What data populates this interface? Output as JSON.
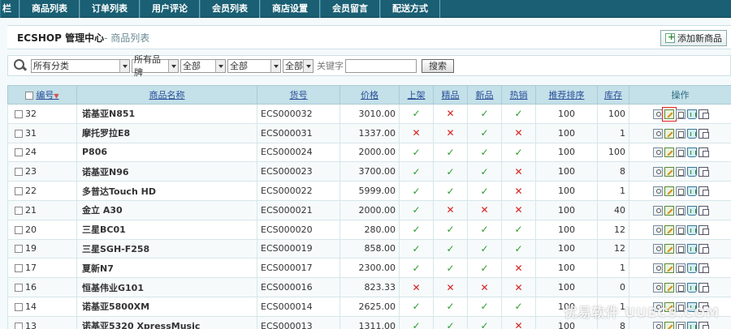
{
  "topnav": {
    "tabs": [
      {
        "label": "栏",
        "width": 24
      },
      {
        "label": "商品列表",
        "width": 74
      },
      {
        "label": "订单列表",
        "width": 74
      },
      {
        "label": "用户评论",
        "width": 74
      },
      {
        "label": "会员列表",
        "width": 74
      },
      {
        "label": "商店设置",
        "width": 74
      },
      {
        "label": "会员留言",
        "width": 74
      },
      {
        "label": "配送方式",
        "width": 74
      }
    ]
  },
  "header": {
    "title": "ECSHOP 管理中心",
    "subtitle": "- 商品列表",
    "add_button": "添加新商品"
  },
  "search": {
    "category": "所有分类",
    "brand": "所有品牌",
    "filter1": "全部",
    "filter2": "全部",
    "filter3": "全部",
    "keyword_label": "关键字",
    "keyword_value": "",
    "button": "搜索"
  },
  "table": {
    "columns": {
      "id": "编号",
      "name": "商品名称",
      "sn": "货号",
      "price": "价格",
      "on_sale": "上架",
      "best": "精品",
      "new": "新品",
      "hot": "热销",
      "sort": "推荐排序",
      "stock": "库存",
      "ops": "操作"
    },
    "rows": [
      {
        "id": "32",
        "name": "诺基亚N851",
        "sn": "ECS000032",
        "price": "3010.00",
        "on_sale": true,
        "best": false,
        "new": true,
        "hot": true,
        "sort": "100",
        "stock": "100"
      },
      {
        "id": "31",
        "name": "摩托罗拉E8",
        "sn": "ECS000031",
        "price": "1337.00",
        "on_sale": false,
        "best": false,
        "new": true,
        "hot": false,
        "sort": "100",
        "stock": "1"
      },
      {
        "id": "24",
        "name": "P806",
        "sn": "ECS000024",
        "price": "2000.00",
        "on_sale": true,
        "best": true,
        "new": true,
        "hot": true,
        "sort": "100",
        "stock": "100"
      },
      {
        "id": "23",
        "name": "诺基亚N96",
        "sn": "ECS000023",
        "price": "3700.00",
        "on_sale": true,
        "best": true,
        "new": true,
        "hot": false,
        "sort": "100",
        "stock": "8"
      },
      {
        "id": "22",
        "name": "多普达Touch HD",
        "sn": "ECS000022",
        "price": "5999.00",
        "on_sale": true,
        "best": true,
        "new": true,
        "hot": false,
        "sort": "100",
        "stock": "1"
      },
      {
        "id": "21",
        "name": "金立 A30",
        "sn": "ECS000021",
        "price": "2000.00",
        "on_sale": true,
        "best": false,
        "new": false,
        "hot": false,
        "sort": "100",
        "stock": "40"
      },
      {
        "id": "20",
        "name": "三星BC01",
        "sn": "ECS000020",
        "price": "280.00",
        "on_sale": true,
        "best": true,
        "new": true,
        "hot": true,
        "sort": "100",
        "stock": "12"
      },
      {
        "id": "19",
        "name": "三星SGH-F258",
        "sn": "ECS000019",
        "price": "858.00",
        "on_sale": true,
        "best": true,
        "new": true,
        "hot": true,
        "sort": "100",
        "stock": "12"
      },
      {
        "id": "17",
        "name": "夏新N7",
        "sn": "ECS000017",
        "price": "2300.00",
        "on_sale": true,
        "best": true,
        "new": true,
        "hot": false,
        "sort": "100",
        "stock": "1"
      },
      {
        "id": "16",
        "name": "恒基伟业G101",
        "sn": "ECS000016",
        "price": "823.33",
        "on_sale": false,
        "best": false,
        "new": false,
        "hot": false,
        "sort": "100",
        "stock": "0"
      },
      {
        "id": "14",
        "name": "诺基亚5800XM",
        "sn": "ECS000014",
        "price": "2625.00",
        "on_sale": true,
        "best": true,
        "new": true,
        "hot": true,
        "sort": "100",
        "stock": "1"
      },
      {
        "id": "13",
        "name": "诺基亚5320 XpressMusic",
        "sn": "ECS000013",
        "price": "1311.00",
        "on_sale": true,
        "best": true,
        "new": true,
        "hot": false,
        "sort": "100",
        "stock": "8"
      }
    ]
  },
  "icons": {
    "yes_glyph": "✓",
    "no_glyph": "✕",
    "yes_color": "#2c9b2c",
    "no_color": "#d62020"
  },
  "watermark": "优易软件 UUECS.COM"
}
